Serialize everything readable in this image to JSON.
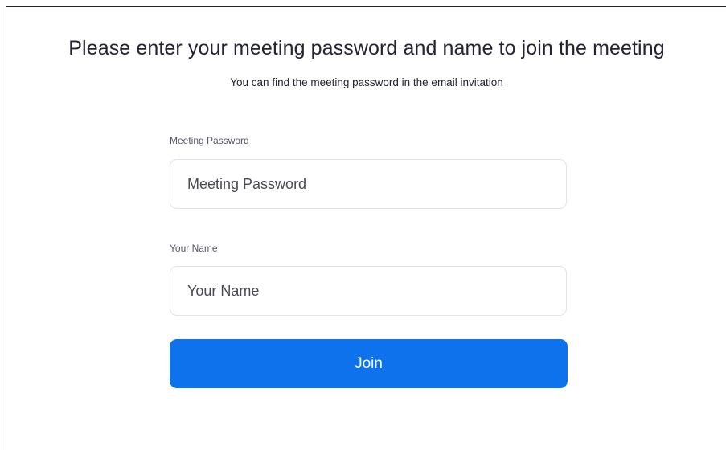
{
  "dialog": {
    "title": "Please enter your meeting password and name to join the meeting",
    "subtitle": "You can find the meeting password in the email invitation"
  },
  "password_field": {
    "label": "Meeting Password",
    "placeholder": "Meeting Password",
    "value": ""
  },
  "name_field": {
    "label": "Your Name",
    "placeholder": "Your Name",
    "value": ""
  },
  "join_button": {
    "label": "Join"
  },
  "colors": {
    "accent": "#0e72ed",
    "text": "#232333",
    "border": "#e3e3e8"
  }
}
